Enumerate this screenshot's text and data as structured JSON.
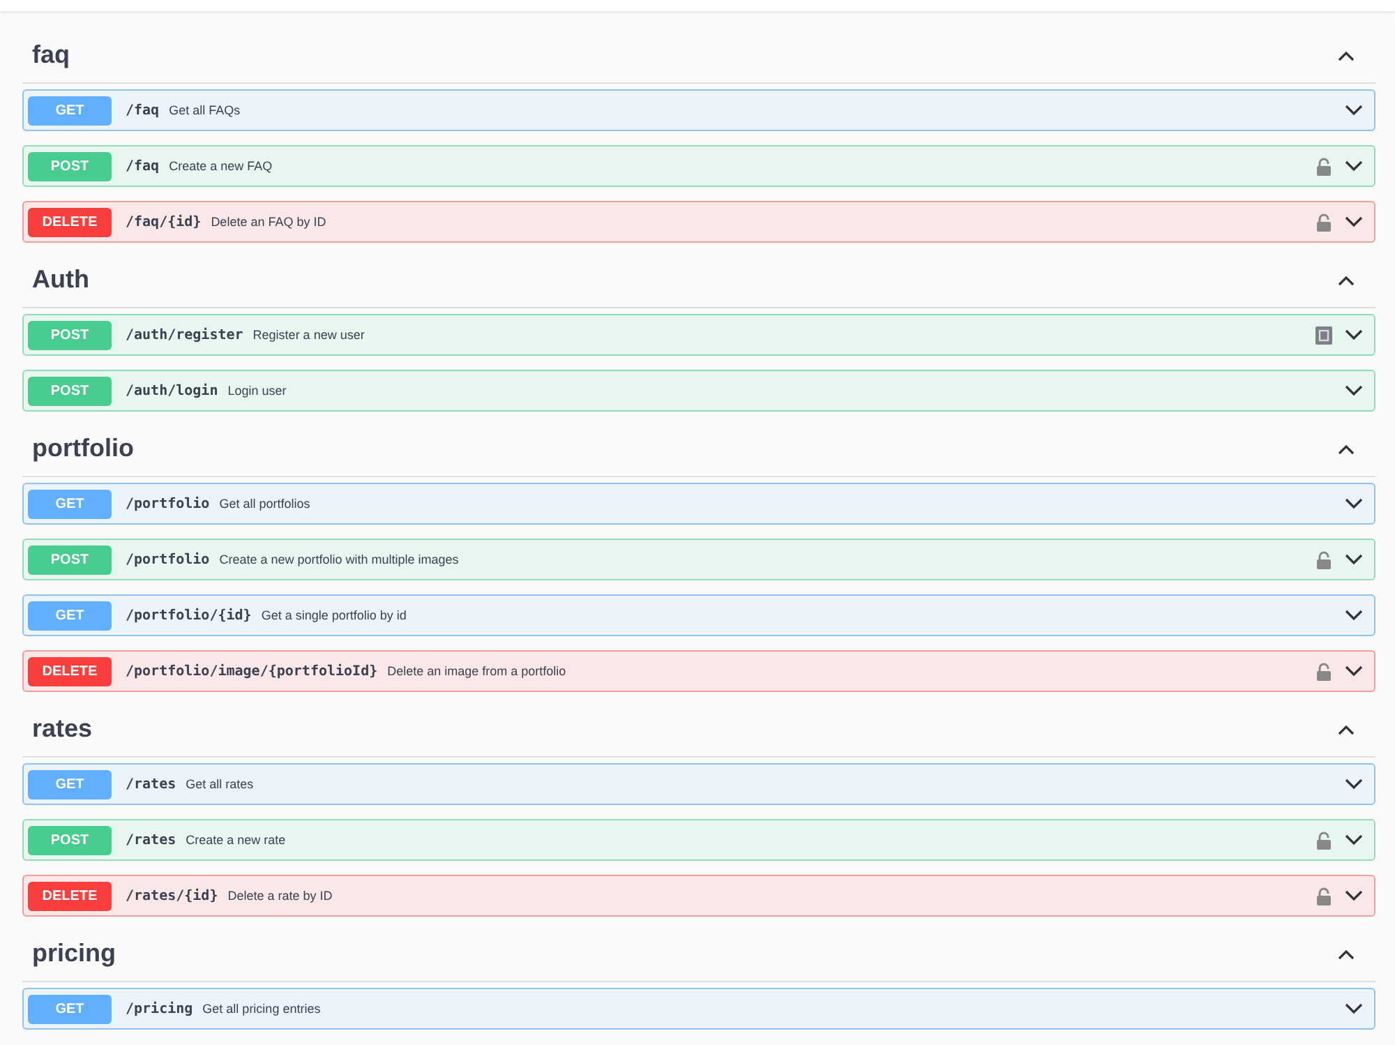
{
  "sections": [
    {
      "title": "faq",
      "expanded": true,
      "operations": [
        {
          "method": "GET",
          "path": "/faq",
          "summary": "Get all FAQs"
        },
        {
          "method": "POST",
          "path": "/faq",
          "summary": "Create a new FAQ",
          "kind": "locked"
        },
        {
          "method": "DELETE",
          "path": "/faq/{id}",
          "summary": "Delete an FAQ by ID",
          "kind": "locked"
        }
      ]
    },
    {
      "title": "Auth",
      "expanded": true,
      "operations": [
        {
          "method": "POST",
          "path": "/auth/register",
          "summary": "Register a new user",
          "kind": "form"
        },
        {
          "method": "POST",
          "path": "/auth/login",
          "summary": "Login user"
        }
      ]
    },
    {
      "title": "portfolio",
      "expanded": true,
      "operations": [
        {
          "method": "GET",
          "path": "/portfolio",
          "summary": "Get all portfolios"
        },
        {
          "method": "POST",
          "path": "/portfolio",
          "summary": "Create a new portfolio with multiple images",
          "kind": "locked"
        },
        {
          "method": "GET",
          "path": "/portfolio/{id}",
          "summary": "Get a single portfolio by id"
        },
        {
          "method": "DELETE",
          "path": "/portfolio/image/{portfolioId}",
          "summary": "Delete an image from a portfolio",
          "kind": "locked"
        }
      ]
    },
    {
      "title": "rates",
      "expanded": true,
      "operations": [
        {
          "method": "GET",
          "path": "/rates",
          "summary": "Get all rates"
        },
        {
          "method": "POST",
          "path": "/rates",
          "summary": "Create a new rate",
          "kind": "locked"
        },
        {
          "method": "DELETE",
          "path": "/rates/{id}",
          "summary": "Delete a rate by ID",
          "kind": "locked"
        }
      ]
    },
    {
      "title": "pricing",
      "expanded": true,
      "operations": [
        {
          "method": "GET",
          "path": "/pricing",
          "summary": "Get all pricing entries"
        }
      ]
    }
  ]
}
